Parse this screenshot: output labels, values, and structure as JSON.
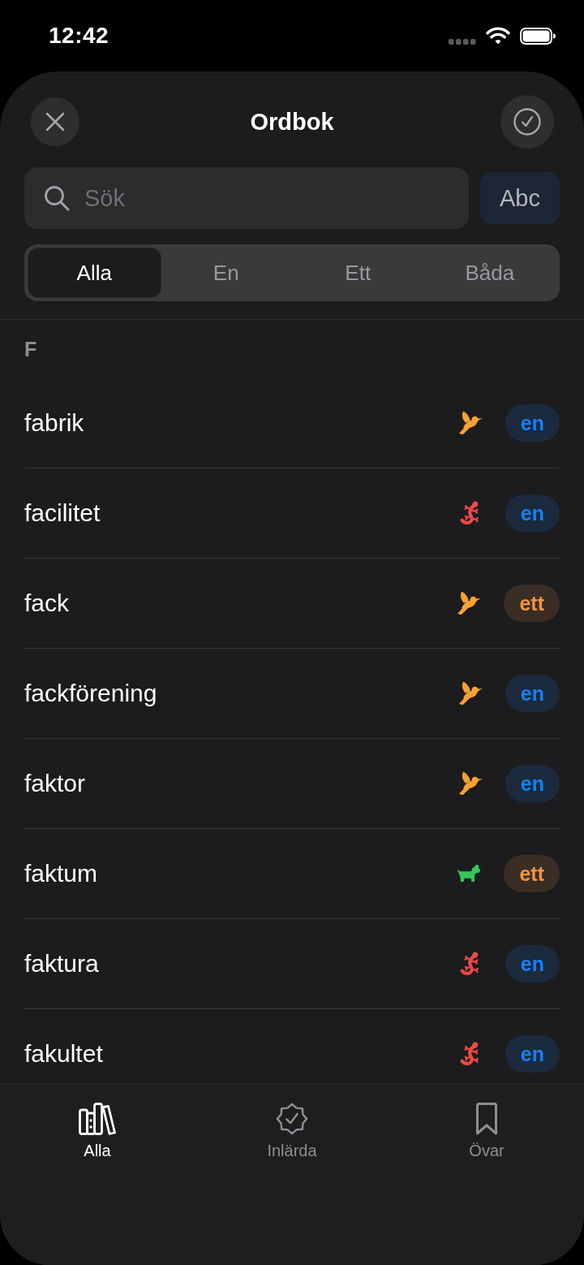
{
  "status_bar": {
    "time": "12:42"
  },
  "header": {
    "title": "Ordbok"
  },
  "search": {
    "placeholder": "Sök",
    "button": "Abc"
  },
  "segments": [
    {
      "label": "Alla",
      "selected": true
    },
    {
      "label": "En",
      "selected": false
    },
    {
      "label": "Ett",
      "selected": false
    },
    {
      "label": "Båda",
      "selected": false
    }
  ],
  "sections": [
    {
      "title": "F",
      "rows": [
        {
          "word": "fabrik",
          "icon": {
            "kind": "bird",
            "color": "#f7a234"
          },
          "article": {
            "text": "en",
            "color": "#1b2a3c"
          }
        },
        {
          "word": "facilitet",
          "icon": {
            "kind": "lizard",
            "color": "#f04848"
          },
          "article": {
            "text": "en",
            "color": "#1b2a3c"
          }
        },
        {
          "word": "fack",
          "icon": {
            "kind": "bird",
            "color": "#f7a234"
          },
          "article": {
            "text": "ett",
            "color": "#3a2d23"
          }
        },
        {
          "word": "fackförening",
          "icon": {
            "kind": "bird",
            "color": "#f7a234"
          },
          "article": {
            "text": "en",
            "color": "#1b2a3c"
          }
        },
        {
          "word": "faktor",
          "icon": {
            "kind": "bird",
            "color": "#f7a234"
          },
          "article": {
            "text": "en",
            "color": "#1b2a3c"
          }
        },
        {
          "word": "faktum",
          "icon": {
            "kind": "dog",
            "color": "#34c759"
          },
          "article": {
            "text": "ett",
            "color": "#3a2d23"
          }
        },
        {
          "word": "faktura",
          "icon": {
            "kind": "lizard",
            "color": "#f04848"
          },
          "article": {
            "text": "en",
            "color": "#1b2a3c"
          }
        },
        {
          "word": "fakultet",
          "icon": {
            "kind": "lizard",
            "color": "#f04848"
          },
          "article": {
            "text": "en",
            "color": "#1b2a3c"
          }
        }
      ]
    }
  ],
  "tab_bar": [
    {
      "label": "Alla",
      "selected": true
    },
    {
      "label": "Inlärda",
      "selected": false
    },
    {
      "label": "Övar",
      "selected": false
    }
  ]
}
